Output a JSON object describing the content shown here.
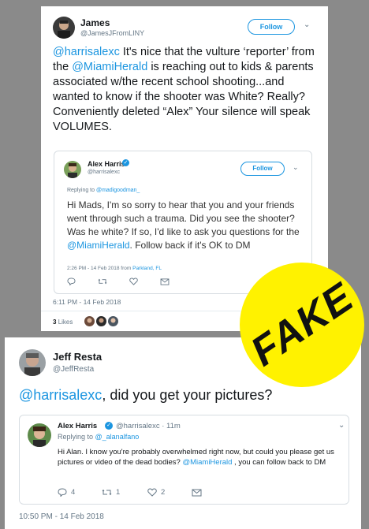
{
  "tweet1": {
    "name": "James",
    "handle": "@JamesJFromLINY",
    "follow_label": "Follow",
    "mention": "@harrisalexc",
    "text_a": " It's nice that the vulture ‘reporter’ from the ",
    "mention2": "@MiamiHerald",
    "text_b": " is reaching out to kids & parents associated w/the recent school shooting...and wanted to know if the shooter was White? Really? Conveniently deleted “Alex” Your silence will speak VOLUMES.",
    "timestamp": "6:11 PM - 14 Feb 2018",
    "likes_count": "3",
    "likes_label": "Likes",
    "quoted": {
      "name": "Alex Harris",
      "handle": "@harrisalexc",
      "follow_label": "Follow",
      "replying_prefix": "Replying to ",
      "replying_to": "@madigoodman_",
      "text_a": "Hi Mads, I'm so sorry to hear that you and your friends went through such a trauma. Did you see the shooter? Was he white? If so, I'd like to ask you questions for the ",
      "mention": "@MiamiHerald",
      "text_b": ". Follow back if it's OK to DM",
      "meta_time": "2:26 PM - 14 Feb 2018 from ",
      "meta_place": "Parkland, FL"
    }
  },
  "tweet2": {
    "name": "Jeff Resta",
    "handle": "@JeffResta",
    "mention": "@harrisalexc",
    "text": ", did you get your pictures?",
    "timestamp": "10:50 PM - 14 Feb 2018",
    "quoted": {
      "name": "Alex Harris",
      "handle_time": "@harrisalexc · 11m",
      "replying_prefix": "Replying to ",
      "replying_to": "@_alanalfano",
      "text_a": "Hi Alan. I know you're probably overwhelmed right now, but could you please get us pictures or video of the dead bodies? ",
      "mention": "@MiamiHerald",
      "text_b": " , you can follow back to DM",
      "reply_count": "4",
      "retweet_count": "1",
      "like_count": "2"
    }
  },
  "badge": {
    "label": "FAKE",
    "color": "#fff200"
  },
  "colors": {
    "link": "#1b95e0",
    "text": "#14171a",
    "muted": "#657786",
    "background": "#8a8a8a"
  }
}
